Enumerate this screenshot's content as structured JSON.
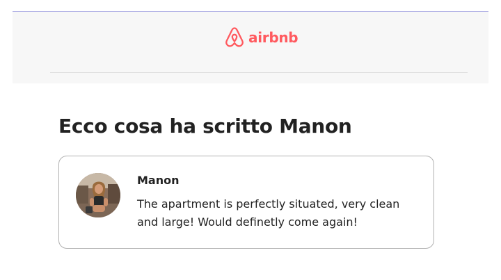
{
  "header": {
    "logo_text": "airbnb",
    "logo_icon": "airbnb-belo-icon",
    "brand_color": "#ff5a5f",
    "background_color": "#f7f7f7"
  },
  "main": {
    "title": "Ecco cosa ha scritto Manon"
  },
  "review": {
    "reviewer_name": "Manon",
    "avatar_icon": "reviewer-photo",
    "text": "The apartment is perfectly situated, very clean and large! Would definetly come again!"
  }
}
